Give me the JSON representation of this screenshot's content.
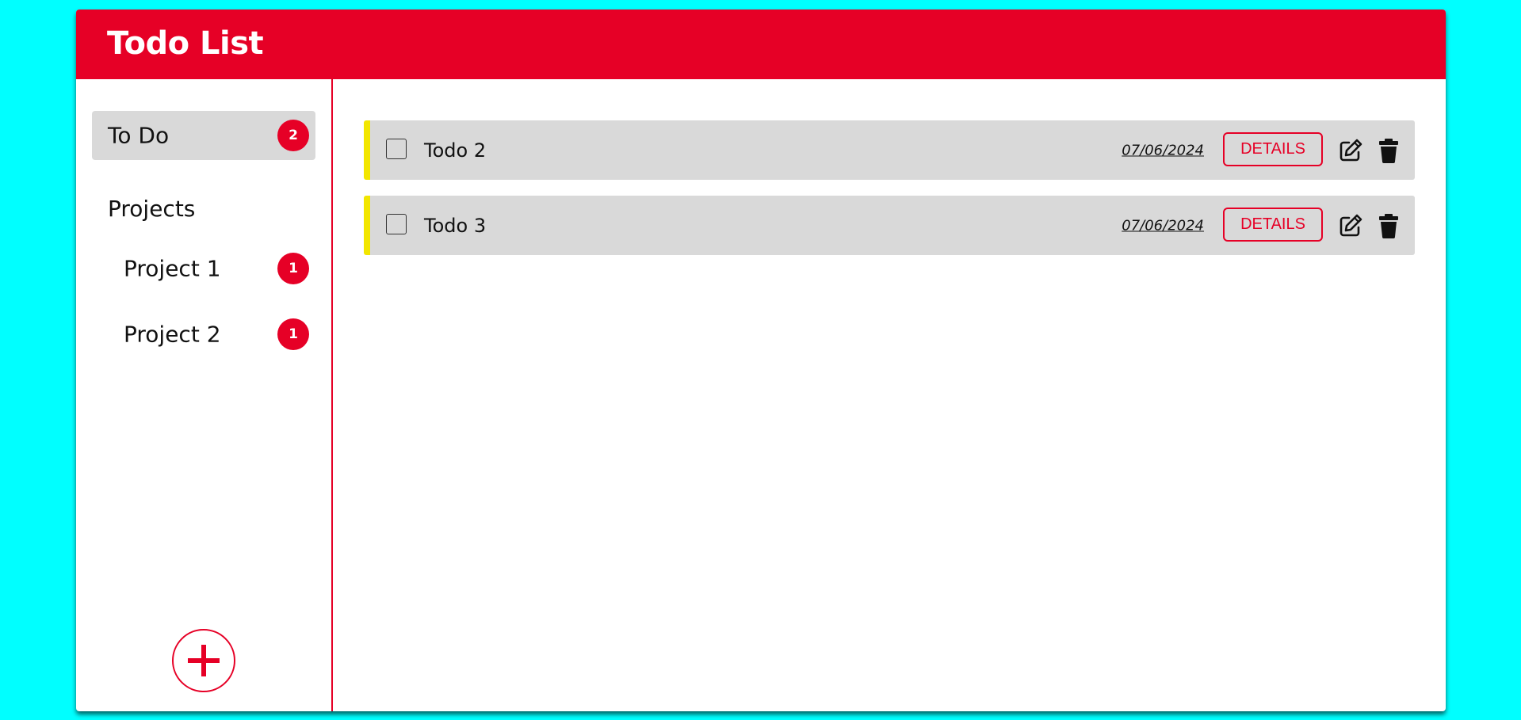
{
  "header": {
    "title": "Todo List"
  },
  "sidebar": {
    "todo": {
      "label": "To Do",
      "count": "2"
    },
    "projects_title": "Projects",
    "projects": [
      {
        "label": "Project 1",
        "count": "1"
      },
      {
        "label": "Project 2",
        "count": "1"
      }
    ],
    "add_icon": "plus-icon"
  },
  "todos": [
    {
      "title": "Todo 2",
      "date": "07/06/2024",
      "details_label": "DETAILS",
      "priority_color": "#f2e600"
    },
    {
      "title": "Todo 3",
      "date": "07/06/2024",
      "details_label": "DETAILS",
      "priority_color": "#f2e600"
    }
  ],
  "colors": {
    "accent": "#e60026",
    "background": "#00ffff",
    "item_bg": "#d9d9d9"
  }
}
